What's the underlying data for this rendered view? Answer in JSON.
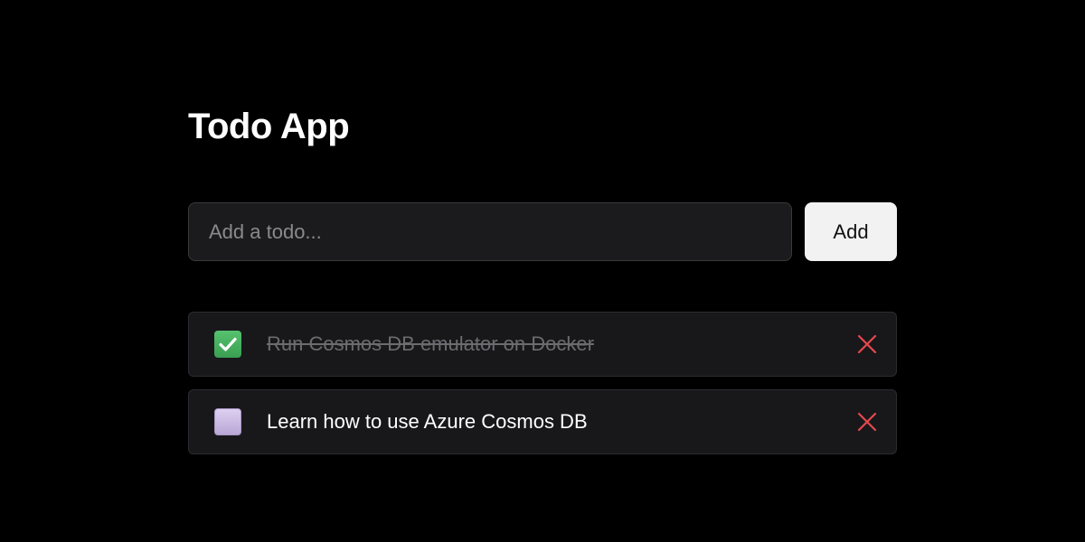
{
  "app": {
    "title": "Todo App"
  },
  "add_form": {
    "placeholder": "Add a todo...",
    "value": "",
    "add_label": "Add"
  },
  "todos": [
    {
      "text": "Run Cosmos DB emulator on Docker",
      "completed": true
    },
    {
      "text": "Learn how to use Azure Cosmos DB",
      "completed": false
    }
  ],
  "icons": {
    "checked": "check-box-icon",
    "unchecked": "empty-box-icon",
    "delete": "close-icon"
  },
  "colors": {
    "background": "#000000",
    "checked_box": "#43b05c",
    "unchecked_box": "#c9b8e3",
    "delete": "#e5484d"
  }
}
